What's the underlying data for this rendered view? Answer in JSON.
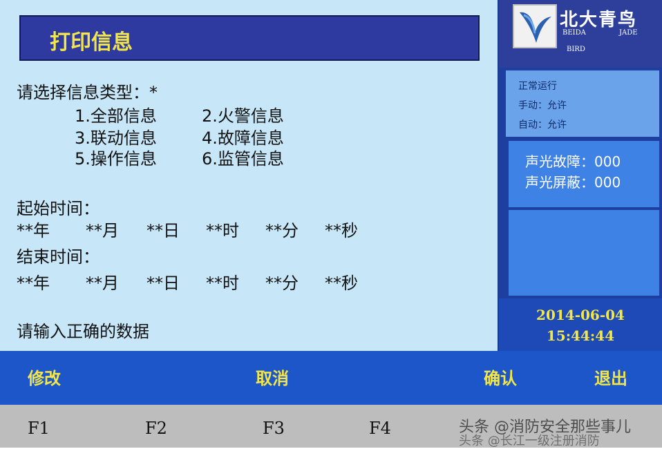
{
  "title": "打印信息",
  "prompt": "请选择信息类型：*",
  "info_types": [
    "1.全部信息",
    "2.火警信息",
    "3.联动信息",
    "4.故障信息",
    "5.操作信息",
    "6.监管信息"
  ],
  "start_time": {
    "label": "起始时间：",
    "fields": [
      "**年",
      "**月",
      "**日",
      "**时",
      "**分",
      "**秒"
    ]
  },
  "end_time": {
    "label": "结束时间：",
    "fields": [
      "**年",
      "**月",
      "**日",
      "**时",
      "**分",
      "**秒"
    ]
  },
  "message": "请输入正确的数据",
  "logo": {
    "cn": "北大青鸟",
    "en_1": "BEIDA",
    "en_2": "JADE",
    "en_3": "BIRD"
  },
  "status": [
    "正常运行",
    "手动：允许",
    "自动：允许"
  ],
  "alarms": [
    "声光故障：000",
    "声光屏蔽：000"
  ],
  "date": "2014-06-04",
  "time": "15:44:44",
  "function_buttons": [
    "修改",
    "取消",
    "确认",
    "退出"
  ],
  "keys": [
    "F1",
    "F2",
    "F3",
    "F4"
  ],
  "watermark": [
    "头条 @消防安全那些事儿",
    "头条 @长江一级注册消防"
  ],
  "colors": {
    "panel_bg": "#c7e6f7",
    "title_bg": "#2e3aa0",
    "accent_yellow": "#f2e64a",
    "function_bar": "#1c56c8",
    "key_bar": "#bdbdbd"
  }
}
